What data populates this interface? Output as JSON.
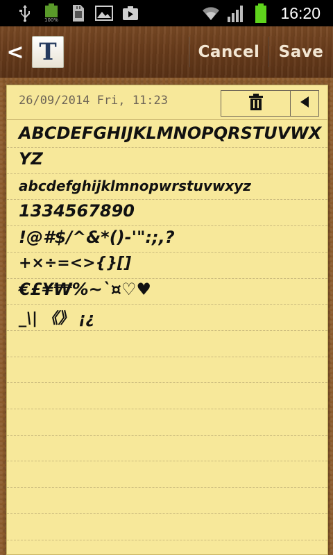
{
  "status_bar": {
    "battery_text": "100%",
    "clock": "16:20",
    "icons": [
      "usb-icon",
      "battery-icon",
      "sd-card-icon",
      "image-icon",
      "media-icon",
      "wifi-icon",
      "signal-icon",
      "battery-charging-icon"
    ]
  },
  "title_bar": {
    "back_glyph": "<",
    "app_icon_letter": "T",
    "cancel_label": "Cancel",
    "save_label": "Save"
  },
  "note": {
    "date": "26/09/2014 Fri, 11:23",
    "lines": [
      "ABCDEFGHIJKLMNOPQRSTUVWX",
      "YZ",
      "abcdefghijklmnopwrstuvwxyz",
      "1334567890",
      "!@#$/^&*()-'\":;,?",
      "+×÷=<>{}[]",
      "€£¥₩%~`¤♡♥",
      "_\\| 《》 ¡¿"
    ]
  }
}
